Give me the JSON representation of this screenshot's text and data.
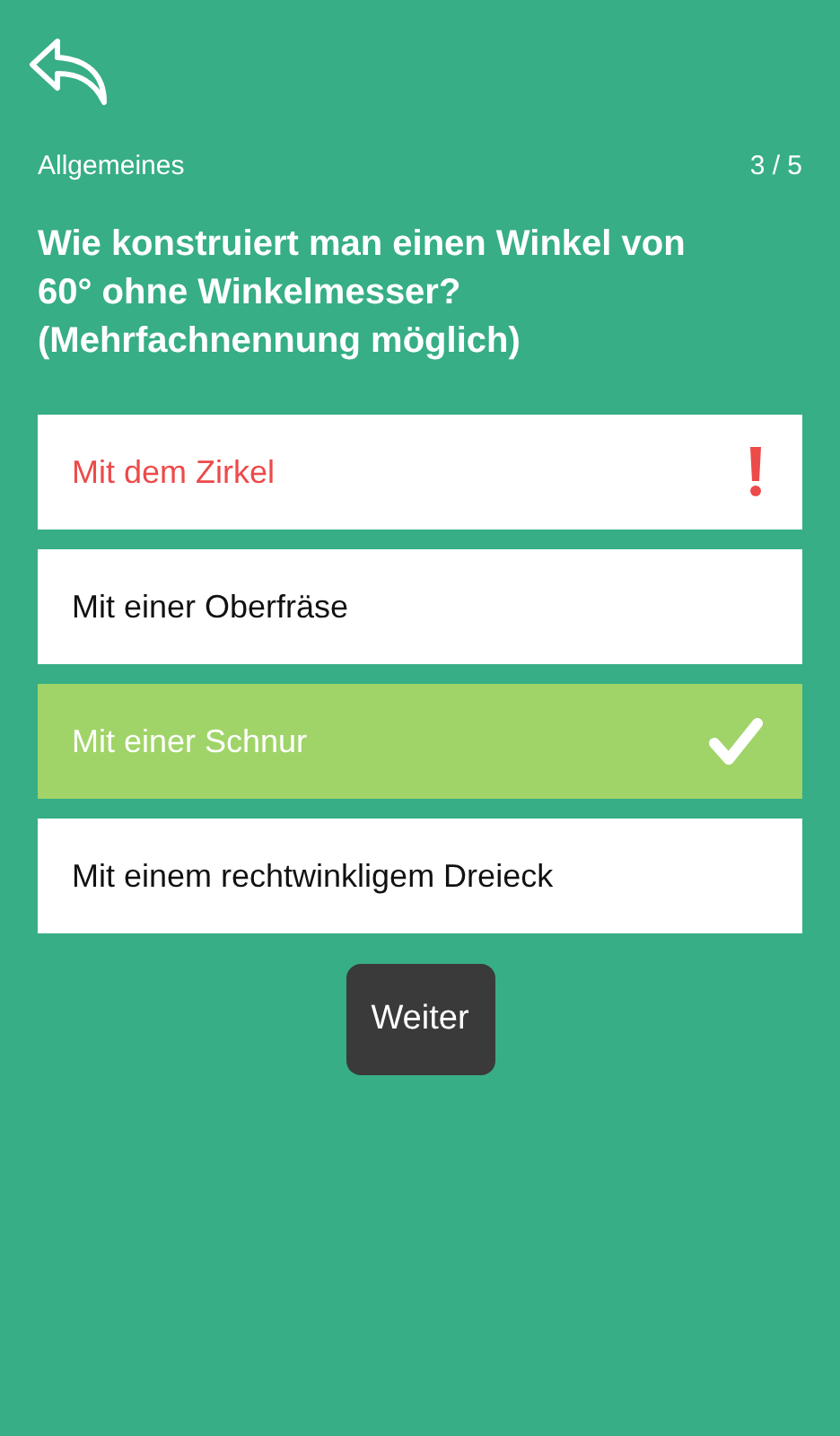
{
  "header": {
    "category": "Allgemeines",
    "progress": "3 / 5"
  },
  "question": "Wie konstruiert man einen Winkel von 60° ohne Winkelmesser? (Mehrfachnennung möglich)",
  "answers": [
    {
      "label": "Mit dem Zirkel",
      "selected": false,
      "missed": true
    },
    {
      "label": "Mit einer Oberfräse",
      "selected": false,
      "missed": false
    },
    {
      "label": "Mit einer Schnur",
      "selected": true,
      "missed": false
    },
    {
      "label": "Mit einem rechtwinkligem Dreieck",
      "selected": false,
      "missed": false
    }
  ],
  "next_button": "Weiter"
}
